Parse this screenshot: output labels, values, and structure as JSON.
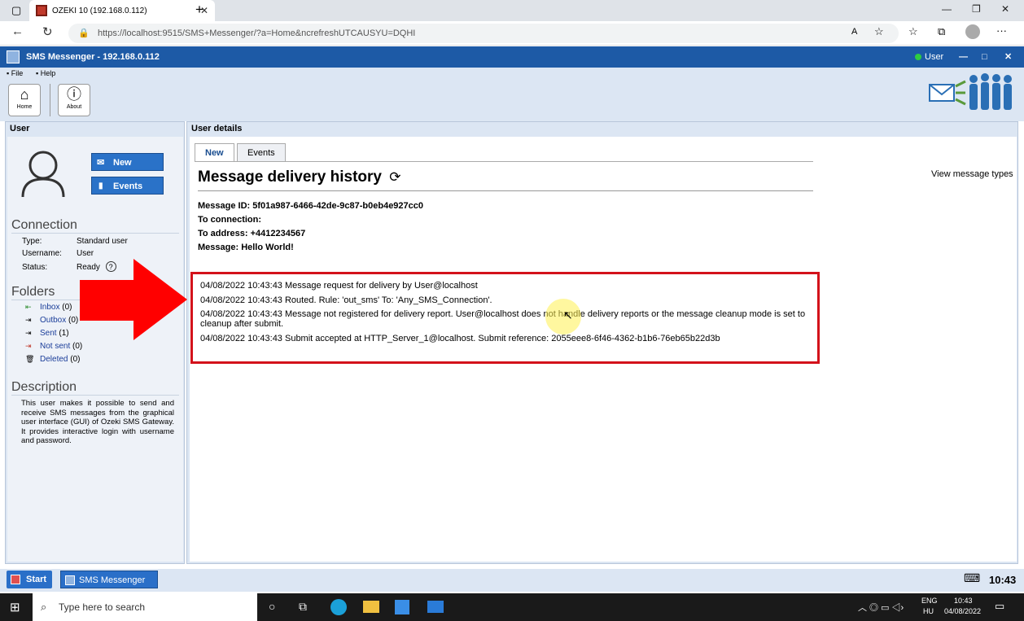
{
  "browser": {
    "tab_title": "OZEKI 10 (192.168.0.112)",
    "url": "https://localhost:9515/SMS+Messenger/?a=Home&ncrefreshUTCAUSYU=DQHI"
  },
  "app": {
    "title": "SMS Messenger - 192.168.0.112",
    "user_label": "User",
    "menu": [
      "File",
      "Help"
    ],
    "toolbar": {
      "home_label": "Home",
      "about_label": "About"
    }
  },
  "left": {
    "header": "User",
    "new_button": "New",
    "events_button": "Events",
    "connection_title": "Connection",
    "connection": [
      {
        "key": "Type:",
        "value": "Standard user"
      },
      {
        "key": "Username:",
        "value": "User"
      },
      {
        "key": "Status:",
        "value": "Ready"
      }
    ],
    "folders_title": "Folders",
    "folders": [
      {
        "name": "Inbox",
        "count": "(0)"
      },
      {
        "name": "Outbox",
        "count": "(0)"
      },
      {
        "name": "Sent",
        "count": "(1)"
      },
      {
        "name": "Not sent",
        "count": "(0)"
      },
      {
        "name": "Deleted",
        "count": "(0)"
      }
    ],
    "description_title": "Description",
    "description": "This user makes it possible to send and receive SMS messages from the graphical user interface (GUI) of Ozeki SMS Gateway. It provides interactive login with username and password."
  },
  "right": {
    "header": "User details",
    "tabs": [
      "New",
      "Events"
    ],
    "active_tab": "New",
    "heading": "Message delivery history",
    "view_types": "View message types",
    "meta": [
      "Message ID: 5f01a987-6466-42de-9c87-b0eb4e927cc0",
      "To connection:",
      "To address: +4412234567",
      "Message: Hello World!"
    ],
    "log": [
      "04/08/2022 10:43:43 Message request for delivery by User@localhost",
      "04/08/2022 10:43:43 Routed. Rule: 'out_sms' To: 'Any_SMS_Connection'.",
      "04/08/2022 10:43:43 Message not registered for delivery report. User@localhost does not handle delivery reports or the message cleanup mode is set to cleanup after submit.",
      "04/08/2022 10:43:43 Submit accepted at HTTP_Server_1@localhost. Submit reference: 2055eee8-6f46-4362-b1b6-76eb65b22d3b"
    ]
  },
  "apptaskbar": {
    "start": "Start",
    "app": "SMS Messenger",
    "time": "10:43"
  },
  "wintaskbar": {
    "search_placeholder": "Type here to search",
    "lang1": "ENG",
    "lang2": "HU",
    "time": "10:43",
    "date": "04/08/2022"
  },
  "colors": {
    "app_blue": "#1d5aa6",
    "panel": "#dce6f3",
    "highlight_red": "#d3121b",
    "arrow_red": "#ff0000"
  }
}
